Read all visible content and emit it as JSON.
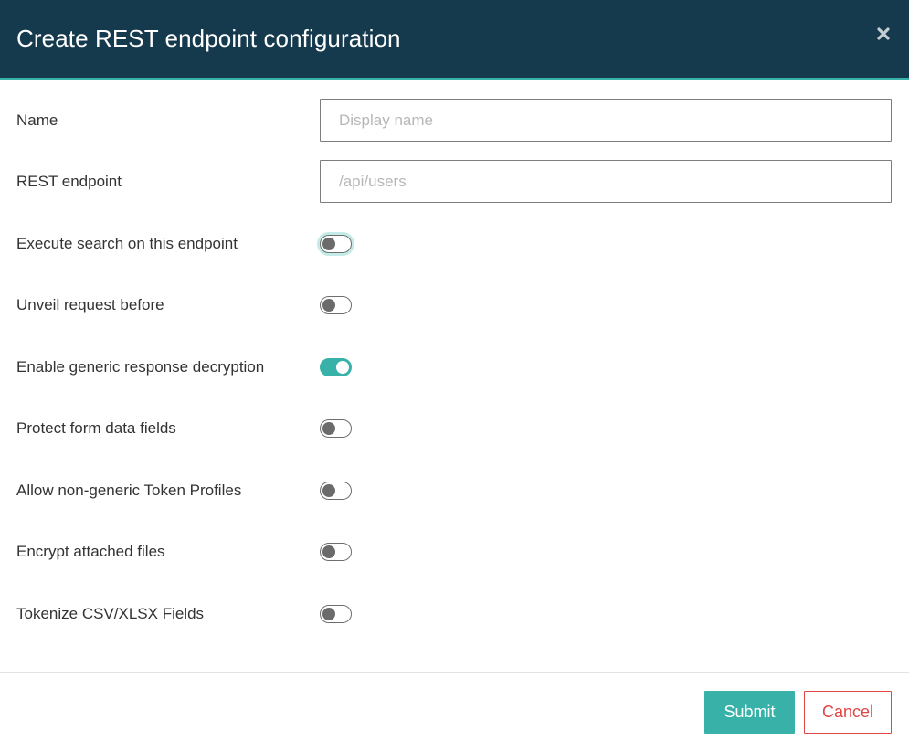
{
  "dialog": {
    "title": "Create REST endpoint configuration",
    "close_icon": "close-icon"
  },
  "fields": {
    "name": {
      "label": "Name",
      "value": "",
      "placeholder": "Display name"
    },
    "rest_endpoint": {
      "label": "REST endpoint",
      "value": "",
      "placeholder": "/api/users"
    }
  },
  "toggles": [
    {
      "label": "Execute search on this endpoint",
      "checked": false,
      "focused": true
    },
    {
      "label": "Unveil request before",
      "checked": false,
      "focused": false
    },
    {
      "label": "Enable generic response decryption",
      "checked": true,
      "focused": false
    },
    {
      "label": "Protect form data fields",
      "checked": false,
      "focused": false
    },
    {
      "label": "Allow non-generic Token Profiles",
      "checked": false,
      "focused": false
    },
    {
      "label": "Encrypt attached files",
      "checked": false,
      "focused": false
    },
    {
      "label": "Tokenize CSV/XLSX Fields",
      "checked": false,
      "focused": false
    }
  ],
  "footer": {
    "submit_label": "Submit",
    "cancel_label": "Cancel"
  },
  "colors": {
    "header_bg": "#163a4d",
    "accent": "#38b2a8",
    "danger": "#e04646"
  }
}
